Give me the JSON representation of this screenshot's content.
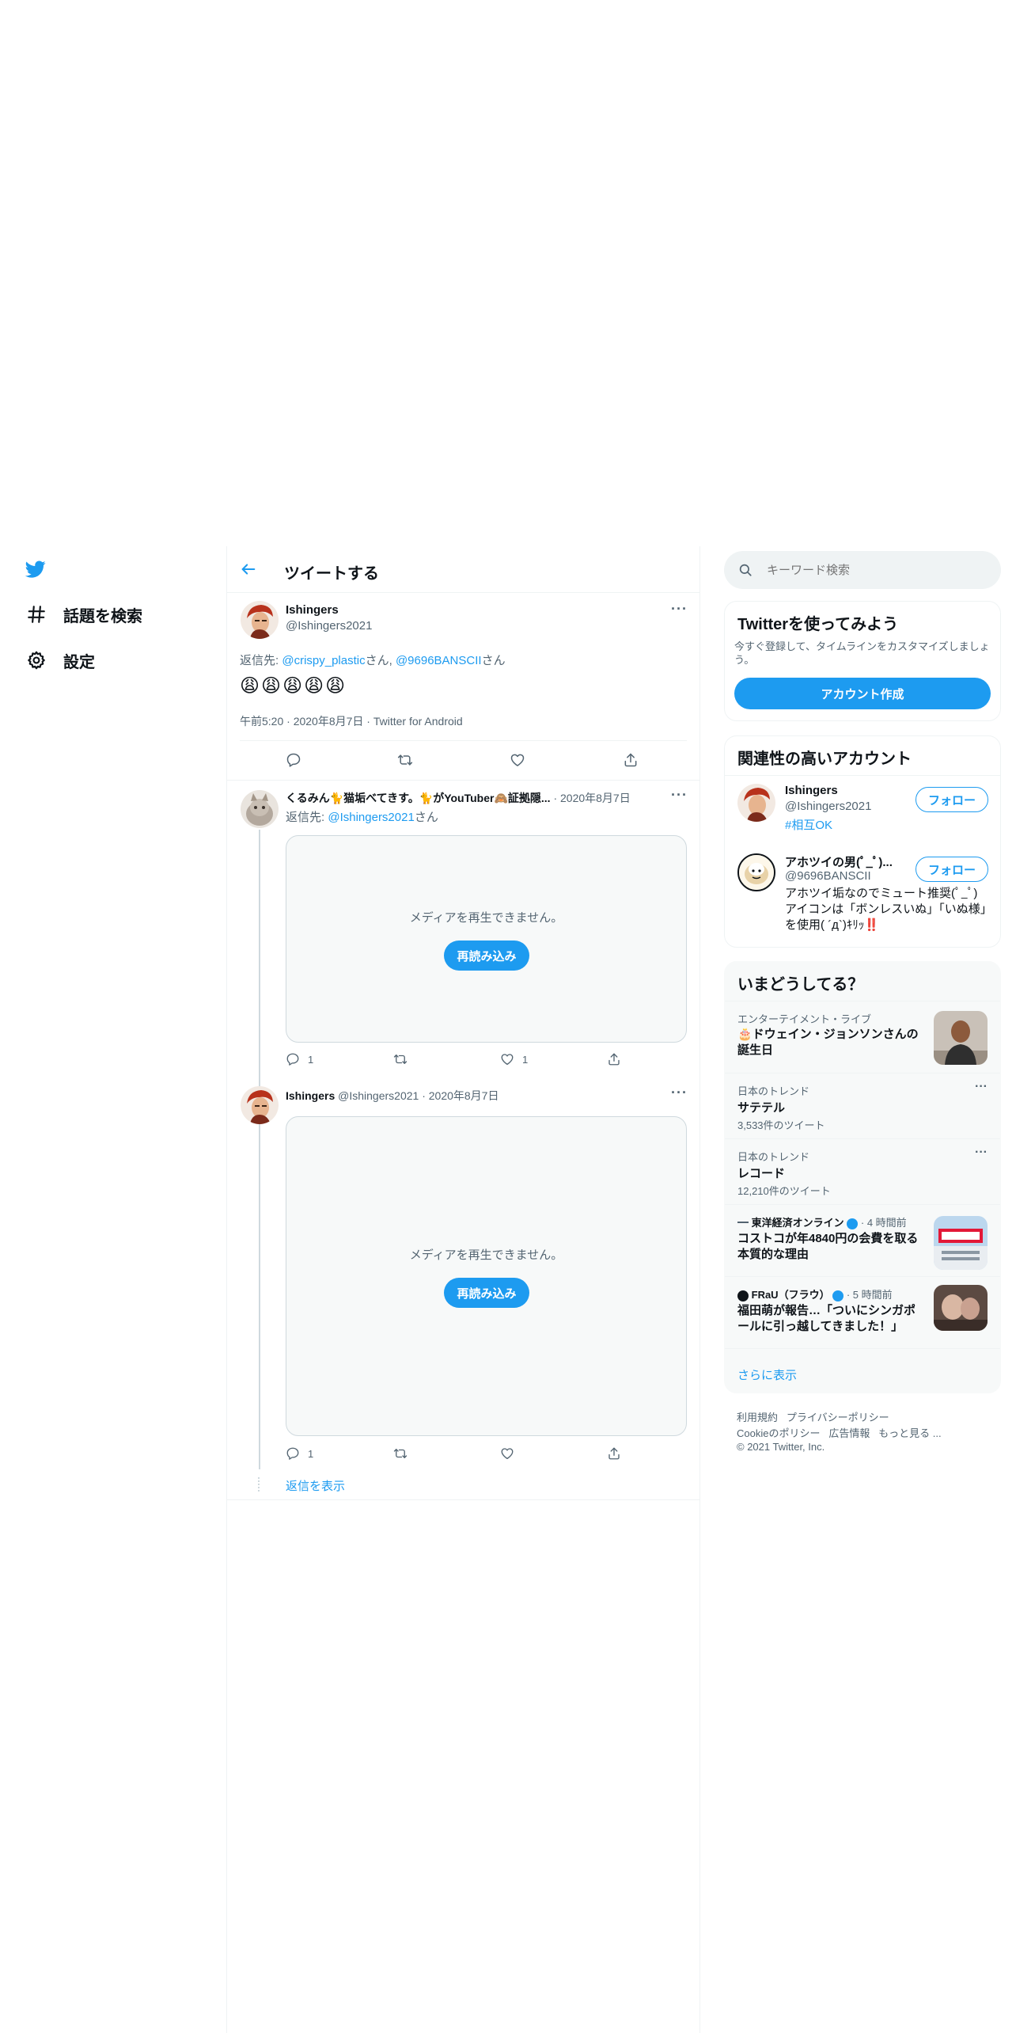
{
  "nav": {
    "logo": "twitter-bird-icon",
    "items": [
      {
        "icon": "hashtag-icon",
        "label": "話題を検索"
      },
      {
        "icon": "gear-icon",
        "label": "設定"
      }
    ]
  },
  "header": {
    "back": "arrow-left-icon",
    "title": "ツイートする"
  },
  "main_tweet": {
    "name": "Ishingers",
    "handle": "@Ishingers2021",
    "reply_prefix": "返信先: ",
    "reply_user1": "@crispy_plastic",
    "reply_mid": "さん, ",
    "reply_user2": "@9696BANSCII",
    "reply_suffix": "さん",
    "emojis": [
      "😩",
      "😩",
      "😩",
      "😩",
      "😩"
    ],
    "timestamp": "午前5:20 · 2020年8月7日 · Twitter for Android",
    "more": "···"
  },
  "reply1": {
    "name": "くるみん🐈猫垢べてきす。🐈がYouTuber🙈証拠隠...",
    "date": "· 2020年8月7日",
    "reply_prefix": "返信先: ",
    "reply_user": "@Ishingers2021",
    "reply_suffix": "さん",
    "media_message": "メディアを再生できません。",
    "reload": "再読み込み",
    "reply_count": "1",
    "like_count": "1",
    "more": "···"
  },
  "reply2": {
    "name": "Ishingers",
    "handle": "@Ishingers2021",
    "date": "· 2020年8月7日",
    "media_message": "メディアを再生できません。",
    "reload": "再読み込み",
    "reply_count": "1",
    "more": "···"
  },
  "show_replies": "返信を表示",
  "search": {
    "placeholder": "キーワード検索"
  },
  "signup": {
    "title": "Twitterを使ってみよう",
    "desc": "今すぐ登録して、タイムラインをカスタマイズしましょう。",
    "button": "アカウント作成"
  },
  "relevant": {
    "title": "関連性の高いアカウント",
    "accounts": [
      {
        "name": "Ishingers",
        "handle": "@Ishingers2021",
        "bio": "#相互OK",
        "follow": "フォロー"
      },
      {
        "name": "アホツイの男(ﾟ_ﾟ)...",
        "handle": "@9696BANSCII",
        "bio": "アホツイ垢なのでミュート推奨(ﾟ_ﾟ) アイコンは「ボンレスいぬ」「いぬ様」を使用( ´д`)ｷﾘｯ‼️",
        "follow": "フォロー"
      }
    ]
  },
  "trends": {
    "title": "いまどうしてる？",
    "items": [
      {
        "meta": "エンターテイメント・ライブ",
        "title": "🎂ドウェイン・ジョンソンさんの誕生日"
      },
      {
        "meta": "日本のトレンド",
        "title": "サテテル",
        "count": "3,533件のツイート"
      },
      {
        "meta": "日本のトレンド",
        "title": "レコード",
        "count": "12,210件のツイート"
      },
      {
        "source": "東洋経済オンライン",
        "time": "· 4 時間前",
        "title": "コストコが年4840円の会費を取る本質的な理由"
      },
      {
        "source": "FRaU（フラウ）",
        "time": "· 5 時間前",
        "title": "福田萌が報告…「ついにシンガポールに引っ越してきました！」"
      }
    ],
    "show_more": "さらに表示"
  },
  "footer": {
    "line1": [
      "利用規約",
      "プライバシーポリシー"
    ],
    "line2": [
      "Cookieのポリシー",
      "広告情報",
      "もっと見る ..."
    ],
    "copyright": "© 2021 Twitter, Inc."
  },
  "colors": {
    "accent": "#1d9bf0",
    "text": "#0f1419",
    "muted": "#536471",
    "border": "#eff3f4"
  }
}
